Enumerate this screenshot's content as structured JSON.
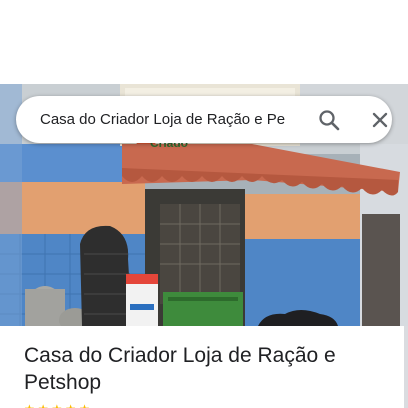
{
  "search": {
    "query": "Casa do Criador Loja de Ração e Pe"
  },
  "icons": {
    "search": "search-icon",
    "close": "close-icon",
    "star": "star-icon"
  },
  "storefront_sign": {
    "text": "Criado"
  },
  "place": {
    "title": "Casa do Criador Loja de Ração e Petshop",
    "rating_stars": 5
  },
  "colors": {
    "awning": "#c8694f",
    "wall_blue": "#4f86c6",
    "wall_orange": "#e2a070",
    "star": "#fbbc04"
  }
}
